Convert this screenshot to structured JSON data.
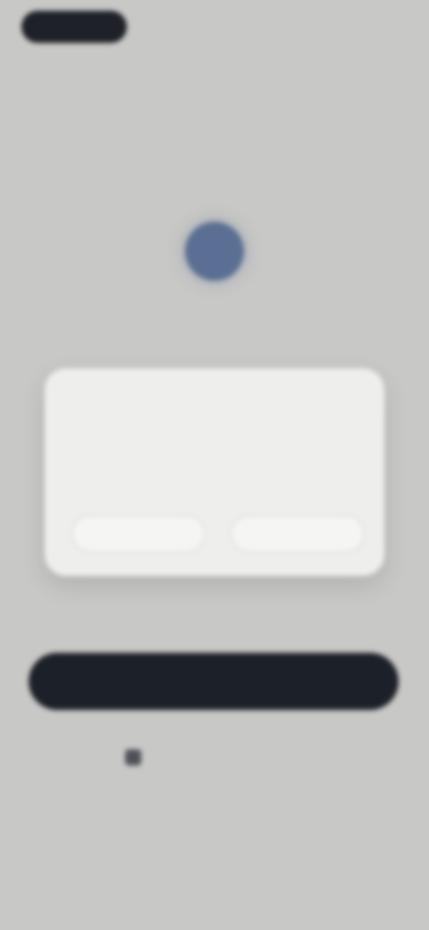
{
  "header": {
    "top_right_link": ""
  },
  "hero": {
    "title": ""
  },
  "card": {
    "title": "",
    "text": "",
    "left_button": "",
    "right_button": ""
  },
  "actions": {
    "primary_button": "",
    "secondary_link": ""
  },
  "footer": {
    "line1": "",
    "line2": ""
  },
  "colors": {
    "background": "#c8c8c6",
    "primary_button": "#1c2028",
    "hero_icon": "#5a6f93",
    "card": "#eeeeed"
  },
  "icons": {
    "hero": "avatar-circle-icon",
    "secondary": "link-icon"
  }
}
